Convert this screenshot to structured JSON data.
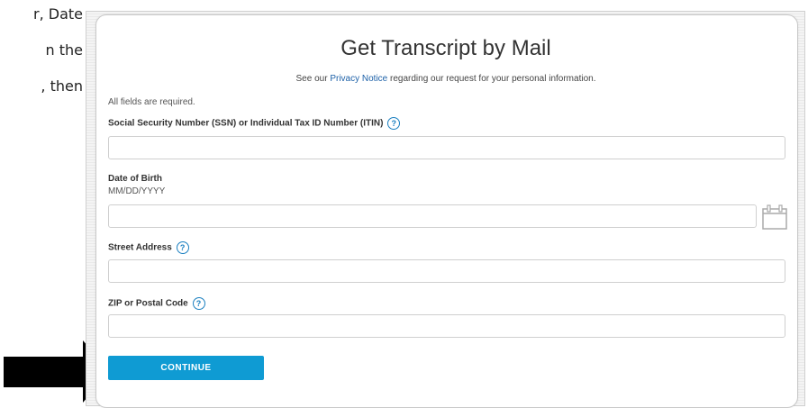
{
  "side_text": {
    "line1": "r, Date",
    "line2": "n the",
    "line3": ", then"
  },
  "form": {
    "title": "Get Transcript by Mail",
    "privacy": {
      "prefix": "See our",
      "link": "Privacy Notice",
      "suffix": "regarding our request for your personal information."
    },
    "required_note": "All fields are required.",
    "ssn": {
      "label": "Social Security Number (SSN) or Individual Tax ID Number (ITIN)",
      "value": ""
    },
    "dob": {
      "label": "Date of Birth",
      "format_hint": "MM/DD/YYYY",
      "value": ""
    },
    "street": {
      "label": "Street Address",
      "value": ""
    },
    "zip": {
      "label": "ZIP or Postal Code",
      "value": ""
    },
    "help_glyph": "?",
    "continue_label": "CONTINUE"
  },
  "icons": {
    "help": "help-icon",
    "calendar": "calendar-icon",
    "arrow": "arrow-right-icon"
  },
  "colors": {
    "accent": "#0f9bd3",
    "link": "#1d61a8",
    "help": "#1a7fc0"
  }
}
